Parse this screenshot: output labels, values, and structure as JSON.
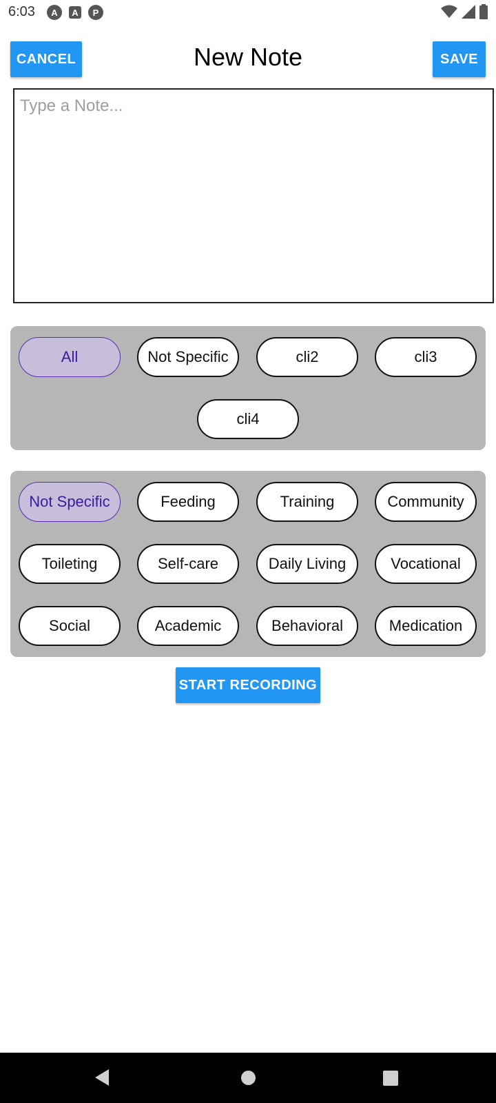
{
  "status_bar": {
    "time": "6:03",
    "left_icons": [
      "A",
      "A",
      "P"
    ]
  },
  "header": {
    "title": "New Note",
    "cancel_label": "CANCEL",
    "save_label": "SAVE"
  },
  "note": {
    "placeholder": "Type a Note..."
  },
  "client_chips": [
    {
      "label": "All",
      "selected": true
    },
    {
      "label": "Not Specific",
      "selected": false
    },
    {
      "label": "cli2",
      "selected": false
    },
    {
      "label": "cli3",
      "selected": false
    },
    {
      "label": "cli4",
      "selected": false
    }
  ],
  "category_chips": [
    {
      "label": "Not Specific",
      "selected": true
    },
    {
      "label": "Feeding",
      "selected": false
    },
    {
      "label": "Training",
      "selected": false
    },
    {
      "label": "Community",
      "selected": false
    },
    {
      "label": "Toileting",
      "selected": false
    },
    {
      "label": "Self-care",
      "selected": false
    },
    {
      "label": "Daily Living",
      "selected": false
    },
    {
      "label": "Vocational",
      "selected": false
    },
    {
      "label": "Social",
      "selected": false
    },
    {
      "label": "Academic",
      "selected": false
    },
    {
      "label": "Behavioral",
      "selected": false
    },
    {
      "label": "Medication",
      "selected": false
    }
  ],
  "record": {
    "label": "START RECORDING"
  },
  "colors": {
    "accent": "#2196f3",
    "panel": "#b5b6b5",
    "selected_chip": "#c7bedc",
    "selected_border": "#5b2cb0"
  }
}
